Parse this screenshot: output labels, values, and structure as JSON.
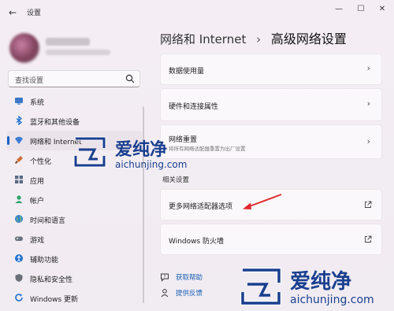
{
  "window": {
    "title": "设置",
    "controls": {
      "minimize": "—",
      "maximize": "☐",
      "close": "✕"
    }
  },
  "search": {
    "placeholder": "查找设置"
  },
  "nav": {
    "items": [
      {
        "label": "系统",
        "icon": "system-icon",
        "color": "#3c78c8"
      },
      {
        "label": "蓝牙和其他设备",
        "icon": "bluetooth-icon",
        "color": "#1e6fd0"
      },
      {
        "label": "网络和 Internet",
        "icon": "network-icon",
        "color": "#3b7bd4",
        "active": true
      },
      {
        "label": "个性化",
        "icon": "brush-icon",
        "color": "#d0703a"
      },
      {
        "label": "应用",
        "icon": "apps-icon",
        "color": "#5a6a86"
      },
      {
        "label": "帐户",
        "icon": "account-icon",
        "color": "#2ea36d"
      },
      {
        "label": "时间和语言",
        "icon": "globe-icon",
        "color": "#2f7fd0"
      },
      {
        "label": "游戏",
        "icon": "gamepad-icon",
        "color": "#6b7280"
      },
      {
        "label": "辅助功能",
        "icon": "accessibility-icon",
        "color": "#1f6fcf"
      },
      {
        "label": "隐私和安全性",
        "icon": "shield-icon",
        "color": "#6b6f78"
      },
      {
        "label": "Windows 更新",
        "icon": "update-icon",
        "color": "#1e6fd0"
      }
    ]
  },
  "breadcrumb": {
    "parent": "网络和 Internet",
    "separator": "›",
    "current": "高级网络设置"
  },
  "cards": [
    {
      "label": "数据使用量",
      "sub": "",
      "action": "›"
    },
    {
      "label": "硬件和连接属性",
      "sub": "",
      "action": "›"
    },
    {
      "label": "网络重置",
      "sub": "将所有网络适配器重置为出厂设置",
      "action": "›"
    }
  ],
  "related": {
    "title": "相关设置",
    "items": [
      {
        "label": "更多网络适配器选项",
        "icon": "external-link-icon"
      },
      {
        "label": "Windows 防火墙",
        "icon": "external-link-icon"
      }
    ]
  },
  "links": [
    {
      "label": "获取帮助",
      "icon": "help-icon"
    },
    {
      "label": "提供反馈",
      "icon": "feedback-icon"
    }
  ],
  "watermark": {
    "brand": "爱纯净",
    "url": "aichunjing.com"
  }
}
